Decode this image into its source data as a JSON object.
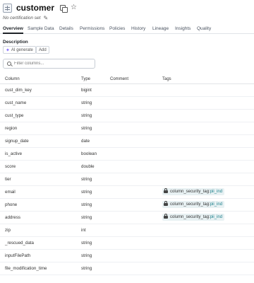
{
  "header": {
    "title": "customer",
    "certification": "No certification set"
  },
  "tabs": [
    "Overview",
    "Sample Data",
    "Details",
    "Permissions",
    "Policies",
    "History",
    "Lineage",
    "Insights",
    "Quality"
  ],
  "description": {
    "label": "Description",
    "ai_button": "AI generate",
    "add_button": "Add"
  },
  "filter": {
    "placeholder": "Filter columns..."
  },
  "table": {
    "headers": {
      "column": "Column",
      "type": "Type",
      "comment": "Comment",
      "tags": "Tags"
    },
    "rows": [
      {
        "name": "cust_dim_key",
        "type": "bigint"
      },
      {
        "name": "cust_name",
        "type": "string"
      },
      {
        "name": "cust_type",
        "type": "string"
      },
      {
        "name": "region",
        "type": "string"
      },
      {
        "name": "signup_date",
        "type": "date"
      },
      {
        "name": "is_active",
        "type": "boolean"
      },
      {
        "name": "score",
        "type": "double"
      },
      {
        "name": "tier",
        "type": "string"
      },
      {
        "name": "email",
        "type": "string",
        "tag_key": "column_security_tag",
        "tag_val": "pii_ind"
      },
      {
        "name": "phone",
        "type": "string",
        "tag_key": "column_security_tag",
        "tag_val": "pii_ind"
      },
      {
        "name": "address",
        "type": "string",
        "tag_key": "column_security_tag",
        "tag_val": "pii_ind"
      },
      {
        "name": "zip",
        "type": "int"
      },
      {
        "name": "_rescued_data",
        "type": "string"
      },
      {
        "name": "inputFilePath",
        "type": "string"
      },
      {
        "name": "file_modification_time",
        "type": "string"
      }
    ]
  },
  "icons": {
    "table": "table-icon",
    "copy": "copy-icon",
    "star": "star-icon",
    "pencil": "pencil-icon",
    "search": "search-icon",
    "lock": "lock-icon",
    "sparkle": "sparkle-icon"
  }
}
